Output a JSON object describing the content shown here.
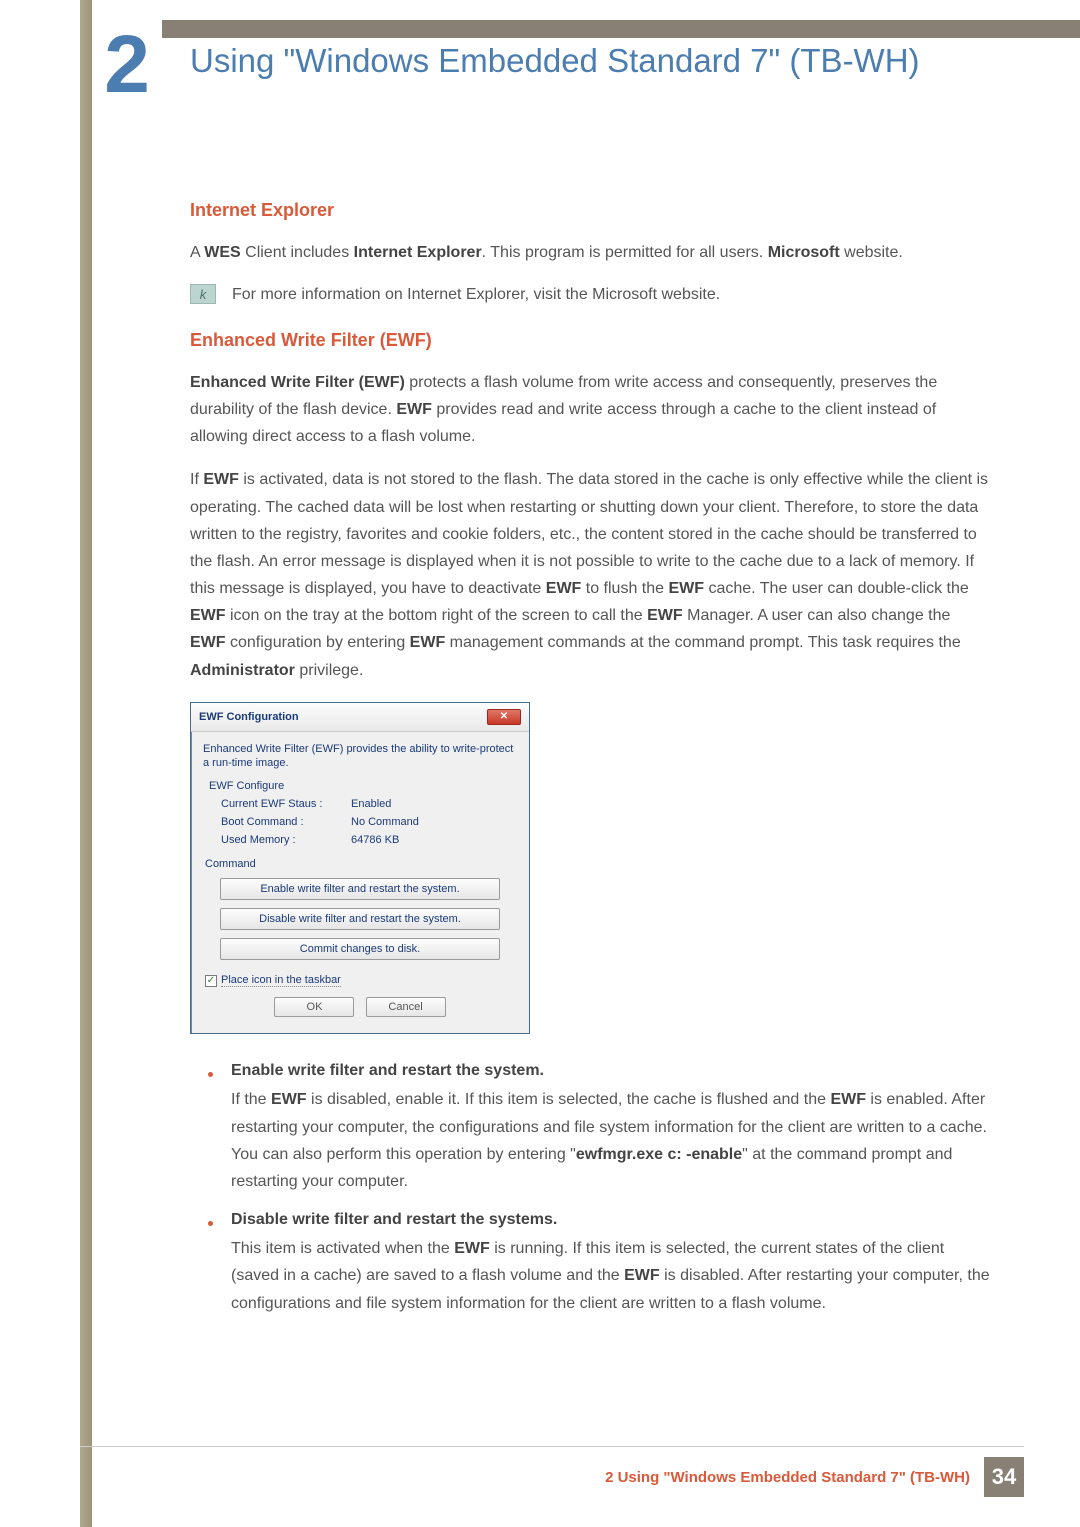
{
  "chapter": {
    "number": "2",
    "title": "Using \"Windows Embedded Standard 7\" (TB-WH)"
  },
  "ie": {
    "heading": "Internet Explorer",
    "p1_a": "A ",
    "p1_b": "WES",
    "p1_c": " Client includes ",
    "p1_d": "Internet Explorer",
    "p1_e": ". This program is permitted for all users. ",
    "p1_f": "Microsoft",
    "p1_g": " website.",
    "note": "For more information on Internet Explorer, visit the Microsoft website."
  },
  "ewf": {
    "heading": "Enhanced Write Filter (EWF)",
    "p1_a": "Enhanced Write Filter (EWF)",
    "p1_b": " protects a flash volume from write access and consequently, preserves the durability of the flash device. ",
    "p1_c": "EWF",
    "p1_d": " provides read and write access through a cache to the client instead of allowing direct access to a flash volume.",
    "p2_a": "If ",
    "p2_b": "EWF",
    "p2_c": " is activated, data is not stored to the flash. The data stored in the cache is only effective while the client is operating. The cached data will be lost when restarting or shutting down your client. Therefore, to store the data written to the registry, favorites and cookie folders, etc., the content stored in the cache should be transferred to the flash. An error message is displayed when it is not possible to write to the cache due to a lack of memory. If this message is displayed, you have to deactivate ",
    "p2_d": "EWF",
    "p2_e": " to flush the ",
    "p2_f": "EWF",
    "p2_g": " cache. The user can double-click the ",
    "p2_h": "EWF",
    "p2_i": " icon on the tray at the bottom right of the screen to call the ",
    "p2_j": "EWF",
    "p2_k": " Manager. A user can also change the ",
    "p2_l": "EWF",
    "p2_m": " configuration by entering ",
    "p2_n": "EWF",
    "p2_o": " management commands at the command prompt. This task requires the ",
    "p2_p": "Administrator",
    "p2_q": " privilege."
  },
  "dialog": {
    "title": "EWF Configuration",
    "desc": "Enhanced Write Filter (EWF) provides the ability to write-protect a run-time image.",
    "configure_label": "EWF Configure",
    "status_label": "Current EWF Staus :",
    "status_value": "Enabled",
    "boot_label": "Boot Command :",
    "boot_value": "No Command",
    "mem_label": "Used Memory :",
    "mem_value": "64786 KB",
    "command_label": "Command",
    "btn_enable": "Enable write filter and restart the system.",
    "btn_disable": "Disable write filter and restart the system.",
    "btn_commit": "Commit changes to disk.",
    "chk_label": "Place icon in the taskbar",
    "ok": "OK",
    "cancel": "Cancel"
  },
  "bullets": {
    "b1_head": "Enable write filter and restart the system.",
    "b1_a": "If the ",
    "b1_b": "EWF",
    "b1_c": " is disabled, enable it. If this item is selected, the cache is flushed and the ",
    "b1_d": "EWF",
    "b1_e": " is enabled. After restarting your computer, the configurations and file system information for the client are written to a cache. You can also perform this operation by entering \"",
    "b1_f": "ewfmgr.exe c: -enable",
    "b1_g": "\" at the command prompt and restarting your computer.",
    "b2_head": "Disable write filter and restart the systems.",
    "b2_a": "This item is activated when the ",
    "b2_b": "EWF",
    "b2_c": " is running. If this item is selected, the current states of the client (saved in a cache) are saved to a flash volume and the ",
    "b2_d": "EWF",
    "b2_e": " is disabled. After restarting your computer, the configurations and file system information for the client are written to a flash volume."
  },
  "footer": {
    "text": "2 Using \"Windows Embedded Standard 7\" (TB-WH)",
    "page": "34"
  }
}
